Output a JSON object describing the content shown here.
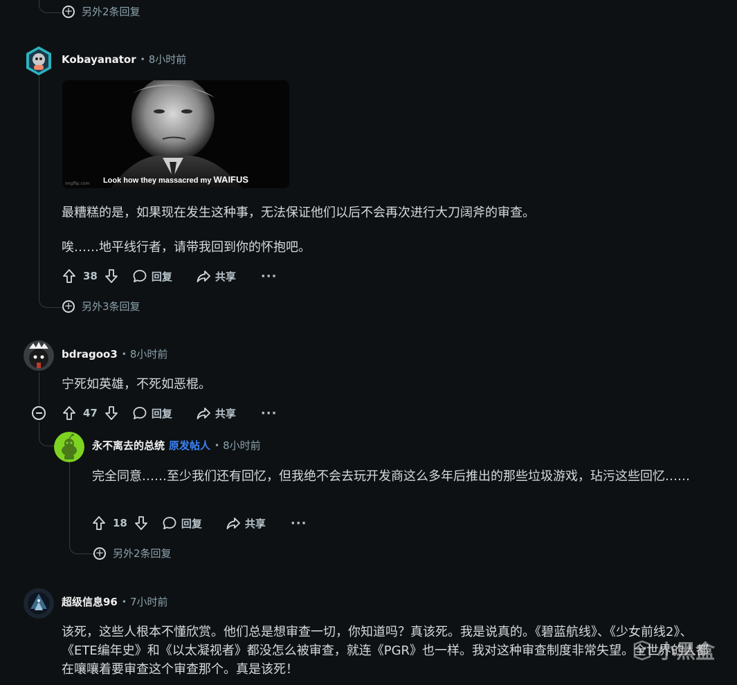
{
  "comments": [
    {
      "id": "kobayanator",
      "author": "Kobayanator",
      "time": "8小时前",
      "gif_caption_prefix": "Look how they massacred my ",
      "gif_caption_emph": "WAIFUS",
      "gif_watermark": "imgflip.com",
      "paragraphs": [
        "最糟糕的是，如果现在发生这种事，无法保证他们以后不会再次进行大刀阔斧的审查。",
        "唉……地平线行者，请带我回到你的怀抱吧。"
      ],
      "score": "38",
      "reply_label": "回复",
      "share_label": "共享",
      "more_label": "···",
      "more_replies": "另外3条回复"
    },
    {
      "id": "bdragoo3",
      "author": "bdragoo3",
      "time": "8小时前",
      "paragraphs": [
        "宁死如英雄，不死如恶棍。"
      ],
      "score": "47",
      "reply_label": "回复",
      "share_label": "共享",
      "more_label": "···"
    },
    {
      "id": "op-reply",
      "author": "永不离去的总统",
      "op_badge": "原发帖人",
      "time": "8小时前",
      "paragraphs": [
        "完全同意……至少我们还有回忆，但我绝不会去玩开发商这么多年后推出的那些垃圾游戏，玷污这些回忆……"
      ],
      "score": "18",
      "reply_label": "回复",
      "share_label": "共享",
      "more_label": "···",
      "more_replies": "另外2条回复"
    },
    {
      "id": "super96",
      "author": "超级信息96",
      "time": "7小时前",
      "paragraphs": [
        "该死，这些人根本不懂欣赏。他们总是想审查一切，你知道吗？真该死。我是说真的。《碧蓝航线》、《少女前线2》、《ETE编年史》和《以太凝视者》都没怎么被审查，就连《PGR》也一样。我对这种审查制度非常失望。全世界的人都在嚷嚷着要审查这个审查那个。真是该死！"
      ]
    }
  ],
  "top_more_replies": "另外2条回复",
  "watermark_text": "小黑盒",
  "colors": {
    "background": "#0e1113",
    "text": "#d7dadc",
    "muted": "#8ba2ad",
    "op_badge": "#3b82f6",
    "thread_line": "#343a3e"
  }
}
